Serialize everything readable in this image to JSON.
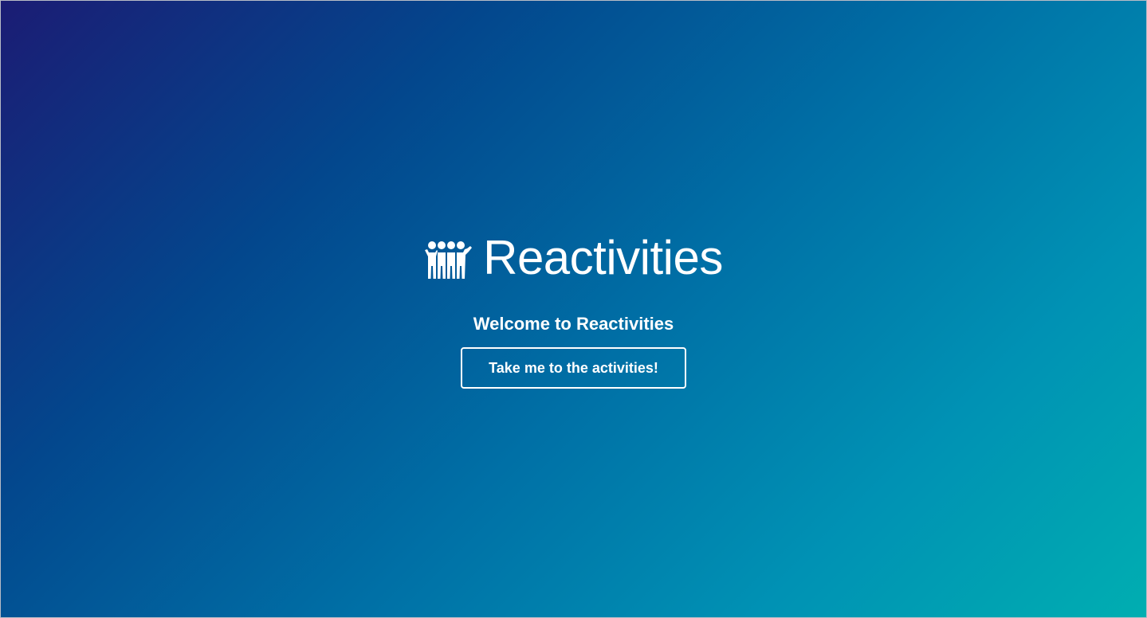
{
  "brand": {
    "logo_icon": "users-icon",
    "title": "Reactivities"
  },
  "hero": {
    "welcome": "Welcome to Reactivities",
    "cta_label": "Take me to the activities!"
  },
  "colors": {
    "gradient_start": "#1b1c74",
    "gradient_mid": "#0070a6",
    "gradient_end": "#00aeb1",
    "text": "#ffffff"
  }
}
